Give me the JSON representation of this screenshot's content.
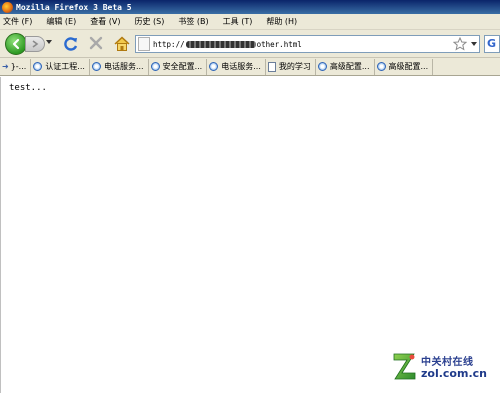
{
  "window": {
    "title": "Mozilla Firefox 3 Beta 5"
  },
  "menu": [
    {
      "label": "文件 (F)"
    },
    {
      "label": "编辑 (E)"
    },
    {
      "label": "查看 (V)"
    },
    {
      "label": "历史 (S)"
    },
    {
      "label": "书签 (B)"
    },
    {
      "label": "工具 (T)"
    },
    {
      "label": "帮助 (H)"
    }
  ],
  "navbar": {
    "url_prefix": "http://",
    "url_suffix": "other.html",
    "search_engine_letter": "G"
  },
  "bookmarks": [
    {
      "label": "}-...",
      "icon": "arrow-icon"
    },
    {
      "label": "认证工程...",
      "icon": "ie-page-icon"
    },
    {
      "label": "电话服务...",
      "icon": "ie-page-icon"
    },
    {
      "label": "安全配置...",
      "icon": "ie-page-icon"
    },
    {
      "label": "电话服务...",
      "icon": "ie-page-icon"
    },
    {
      "label": "我的学习",
      "icon": "document-icon"
    },
    {
      "label": "高级配置...",
      "icon": "ie-page-icon"
    },
    {
      "label": "高级配置...",
      "icon": "ie-page-icon"
    }
  ],
  "content": {
    "text": "test..."
  },
  "watermark": {
    "cn": "中关村在线",
    "en": "zol.com.cn"
  },
  "colors": {
    "titlebar": "#0a246a",
    "chrome": "#ece9d8",
    "back_button": "#2e9a23",
    "watermark": "#1f3a8a"
  }
}
